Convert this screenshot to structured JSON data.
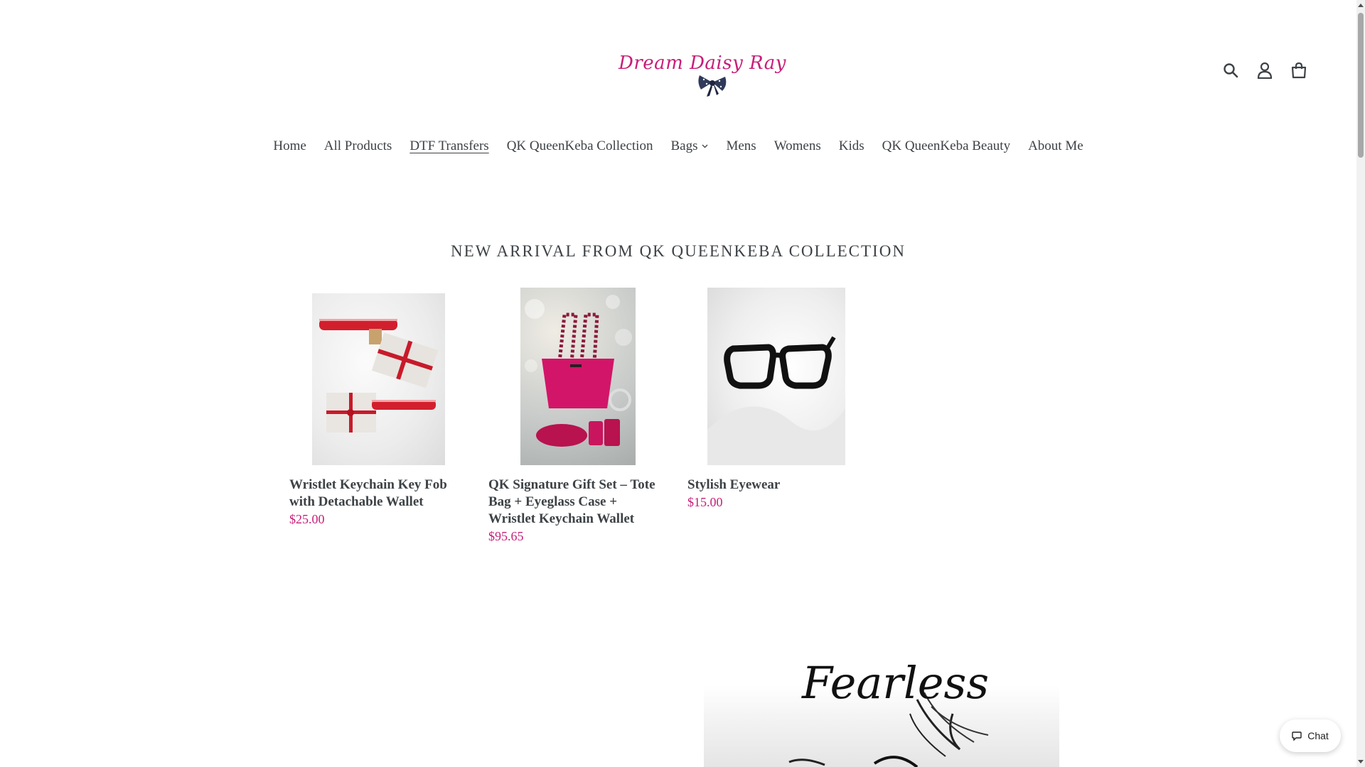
{
  "header": {
    "logo_text": "Dream Daisy Ray",
    "icons": [
      "search-icon",
      "account-icon",
      "cart-icon"
    ]
  },
  "nav": {
    "items": [
      {
        "label": "Home"
      },
      {
        "label": "All Products"
      },
      {
        "label": "DTF Transfers",
        "active": true
      },
      {
        "label": "QK QueenKeba Collection"
      },
      {
        "label": "Bags",
        "has_dropdown": true
      },
      {
        "label": "Mens"
      },
      {
        "label": "Womens"
      },
      {
        "label": "Kids"
      },
      {
        "label": "QK QueenKeba Beauty"
      },
      {
        "label": "About Me"
      }
    ]
  },
  "section": {
    "title": "NEW ARRIVAL FROM QK QUEENKEBA COLLECTION"
  },
  "products": [
    {
      "title": "Wristlet Keychain Key Fob with Detachable Wallet",
      "price": "$25.00"
    },
    {
      "title": "QK Signature Gift Set – Tote Bag + Eyeglass Case + Wristlet Keychain Wallet",
      "price": "$95.65"
    },
    {
      "title": "Stylish Eyewear",
      "price": "$15.00"
    }
  ],
  "hero": {
    "text": "Fearless"
  },
  "chat": {
    "label": "Chat"
  },
  "colors": {
    "brand": "#c81e78",
    "text": "#3d4246"
  }
}
